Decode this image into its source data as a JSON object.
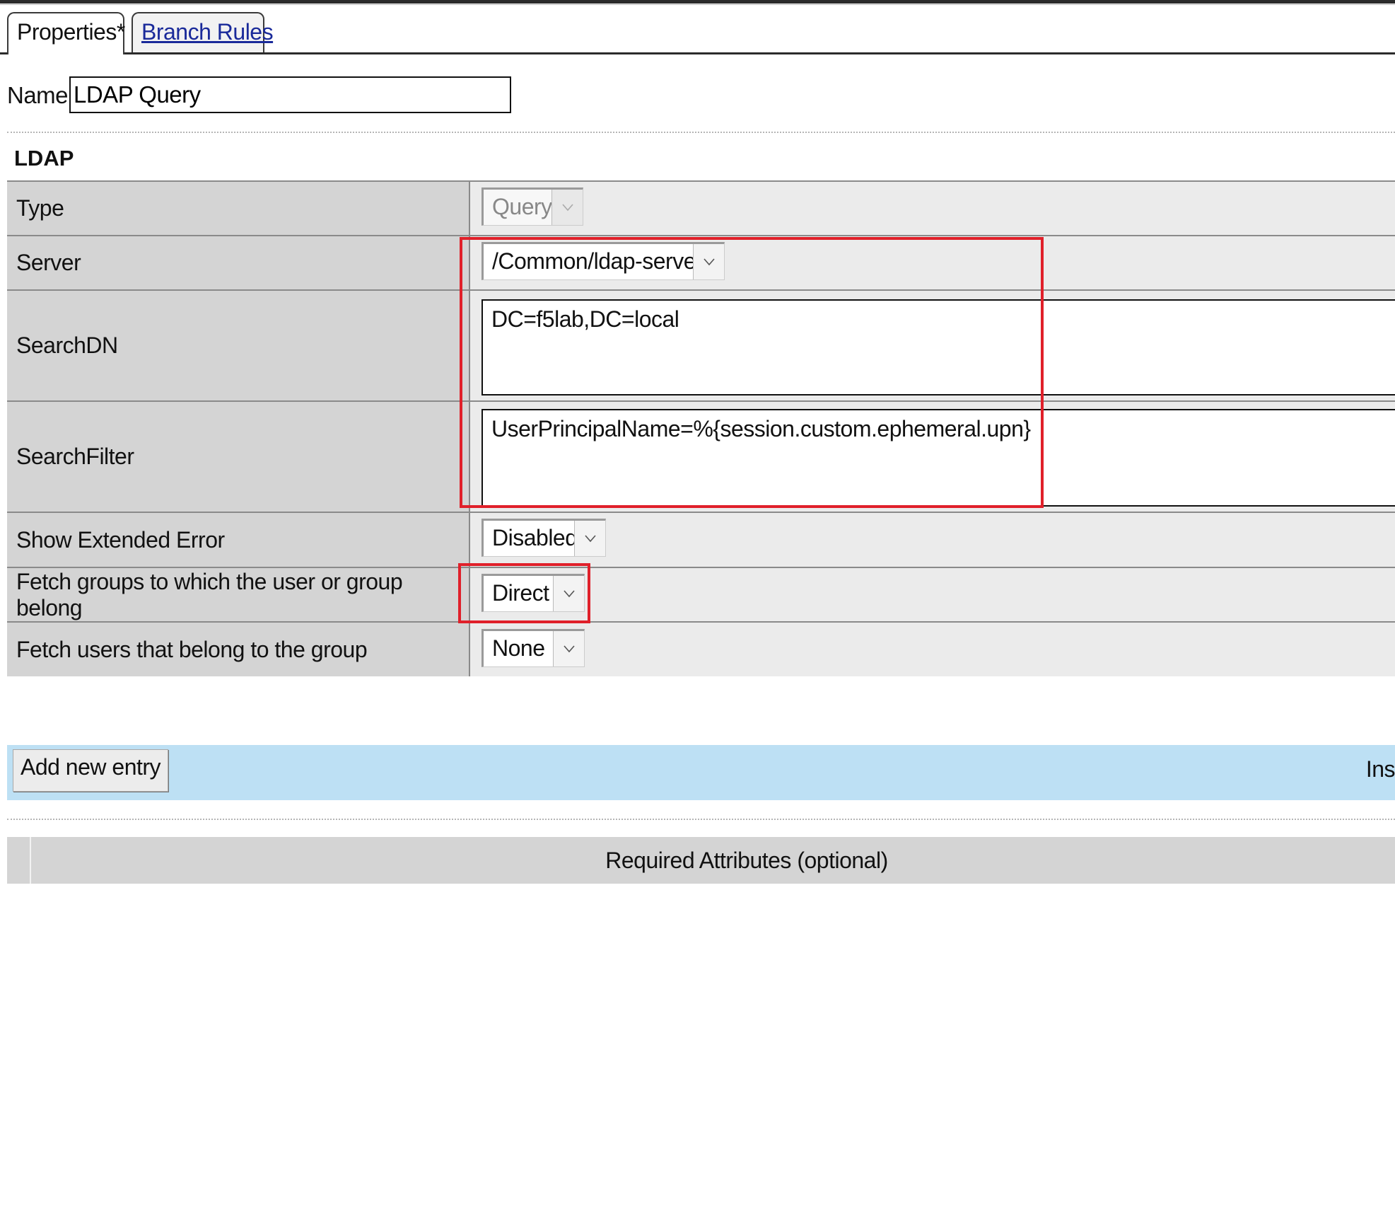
{
  "tabs": {
    "properties": "Properties*",
    "branch_rules": "Branch Rules"
  },
  "name_field": {
    "label": "Name:",
    "value": "LDAP Query"
  },
  "section": {
    "title": "LDAP"
  },
  "rows": {
    "type": {
      "label": "Type",
      "value": "Query"
    },
    "server": {
      "label": "Server",
      "value": "/Common/ldap-servers"
    },
    "searchdn": {
      "label": "SearchDN",
      "value": "DC=f5lab,DC=local"
    },
    "searchfilter": {
      "label": "SearchFilter",
      "value": "UserPrincipalName=%{session.custom.ephemeral.upn}"
    },
    "show_extended_error": {
      "label": "Show Extended Error",
      "value": "Disabled"
    },
    "fetch_groups": {
      "label": "Fetch groups to which the user or group belong",
      "value": "Direct"
    },
    "fetch_users": {
      "label": "Fetch users that belong to the group",
      "value": "None"
    }
  },
  "entry_bar": {
    "add_button": "Add new entry",
    "insert_label": "Ins"
  },
  "required_attributes": {
    "title": "Required Attributes (optional)"
  },
  "colors": {
    "highlight": "#e0202a",
    "entry_bar": "#bde0f4",
    "label_cell": "#d4d4d4",
    "link": "#1a2a9a"
  }
}
